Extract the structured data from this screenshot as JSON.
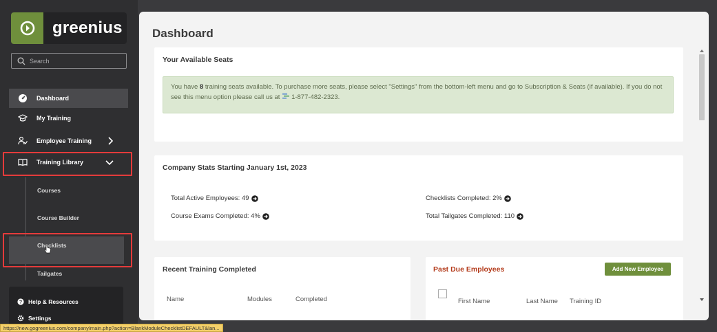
{
  "brand": {
    "name": "greenius",
    "color": "#6f8f3c"
  },
  "search": {
    "placeholder": "Search"
  },
  "nav": {
    "dashboard": "Dashboard",
    "my_training": "My Training",
    "employee_training": "Employee Training",
    "training_library": "Training Library"
  },
  "training_library_sub": {
    "courses": "Courses",
    "course_builder": "Course Builder",
    "checklists": "Checklists",
    "tailgates": "Tailgates"
  },
  "bottom_menu": {
    "help": "Help & Resources",
    "settings": "Settings"
  },
  "status_bar": {
    "url": "https://new.gogreenius.com/company/main.php?action=BlankModuleChecklistDEFAULT&lan..."
  },
  "page": {
    "title": "Dashboard"
  },
  "seats": {
    "title": "Your Available Seats",
    "text_prefix": "You have ",
    "count": "8",
    "text_main": " training seats available. To purchase more seats, please select \"Settings\" from the bottom-left menu and go to Subscription & Seats (if available). If you do not see this menu option please call us at",
    "phone": "1-877-482-2323."
  },
  "company_stats": {
    "title": "Company Stats Starting January 1st, 2023",
    "total_active_employees": "Total Active Employees: 49",
    "course_exams_completed": "Course Exams Completed: 4%",
    "checklists_completed": "Checklists Completed: 2%",
    "total_tailgates_completed": "Total Tailgates Completed: 110"
  },
  "recent_training": {
    "title": "Recent Training Completed",
    "columns": [
      "Name",
      "Modules",
      "Completed"
    ]
  },
  "past_due": {
    "title": "Past Due Employees",
    "add_button": "Add New Employee",
    "columns": [
      "First Name",
      "Last Name",
      "Training ID"
    ],
    "title_color": "#b33a1a"
  },
  "colors": {
    "sidebar_bg": "#2f2f31",
    "highlight": "#e53b3b",
    "alert_bg": "#dce8d2"
  }
}
